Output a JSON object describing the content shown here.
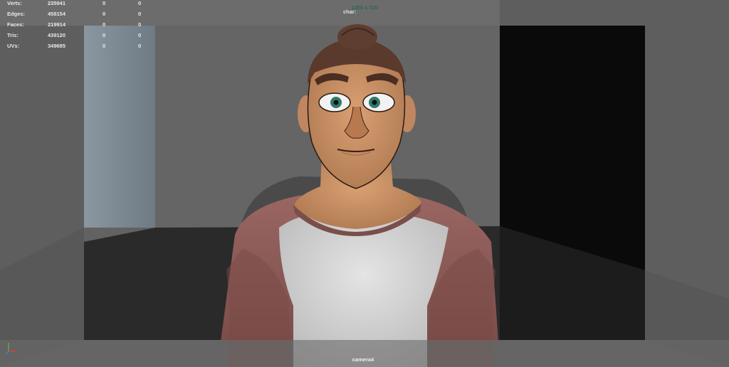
{
  "hud": {
    "stats": [
      {
        "label": "Verts:",
        "v1": "235941",
        "v2": "0",
        "v3": "0"
      },
      {
        "label": "Edges:",
        "v1": "458154",
        "v2": "0",
        "v3": "0"
      },
      {
        "label": "Faces:",
        "v1": "219914",
        "v2": "0",
        "v3": "0"
      },
      {
        "label": "Tris:",
        "v1": "439120",
        "v2": "0",
        "v3": "0"
      },
      {
        "label": "UVs:",
        "v1": "349685",
        "v2": "0",
        "v3": "0"
      }
    ],
    "resolution": "1280 x 720",
    "char_label": "char:",
    "camera_name": "camera4"
  },
  "colors": {
    "viewport_bg": "#5e5e5e",
    "shirt_white": "#d6d6d6",
    "sleeve": "#8a5a56",
    "skin": "#c98f62",
    "hair": "#5a3a2c",
    "iris": "#2f7a6a",
    "resolution_text": "#2a6a4e"
  }
}
